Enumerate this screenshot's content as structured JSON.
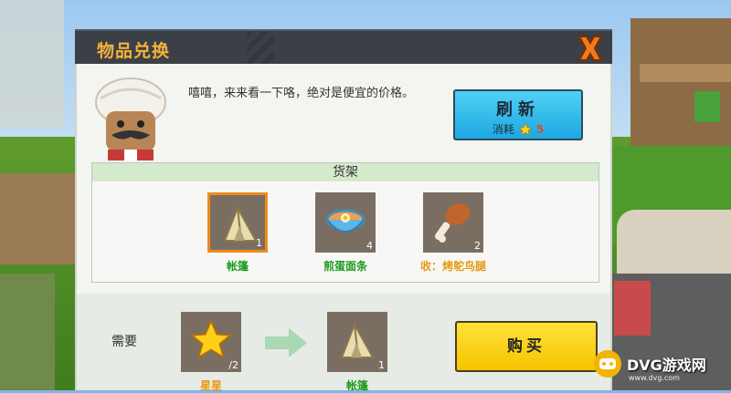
{
  "dialog": {
    "title": "物品兑换",
    "npc_dialogue": "嘻嘻，来来看一下咯，绝对是便宜的价格。",
    "refresh": {
      "label": "刷新",
      "cost_label": "消耗",
      "cost_value": "5",
      "cost_icon": "star-icon"
    },
    "shelf": {
      "title": "货架",
      "items": [
        {
          "name": "帐篷",
          "qty": "1",
          "icon": "tent-icon",
          "selected": true
        },
        {
          "name": "煎蛋面条",
          "qty": "4",
          "icon": "noodle-bowl-icon",
          "selected": false
        },
        {
          "name": "收：烤鸵鸟腿",
          "qty": "2",
          "icon": "drumstick-icon",
          "selected": false
        }
      ]
    },
    "trade": {
      "need_label": "需要",
      "cost_item": {
        "name": "星星",
        "qty": "/2",
        "icon": "star-icon"
      },
      "result_item": {
        "name": "帐篷",
        "qty": "1",
        "icon": "tent-icon"
      },
      "buy_label": "购买"
    }
  },
  "watermark": {
    "text": "DVG游戏网",
    "sub": "www.dvg.com"
  },
  "colors": {
    "title": "#f4b23a",
    "refresh": "#29b9ea",
    "buy": "#f8d21a",
    "selected_border": "#f08a1c",
    "green_text": "#1c9a1c",
    "orange_text": "#e59a12"
  }
}
